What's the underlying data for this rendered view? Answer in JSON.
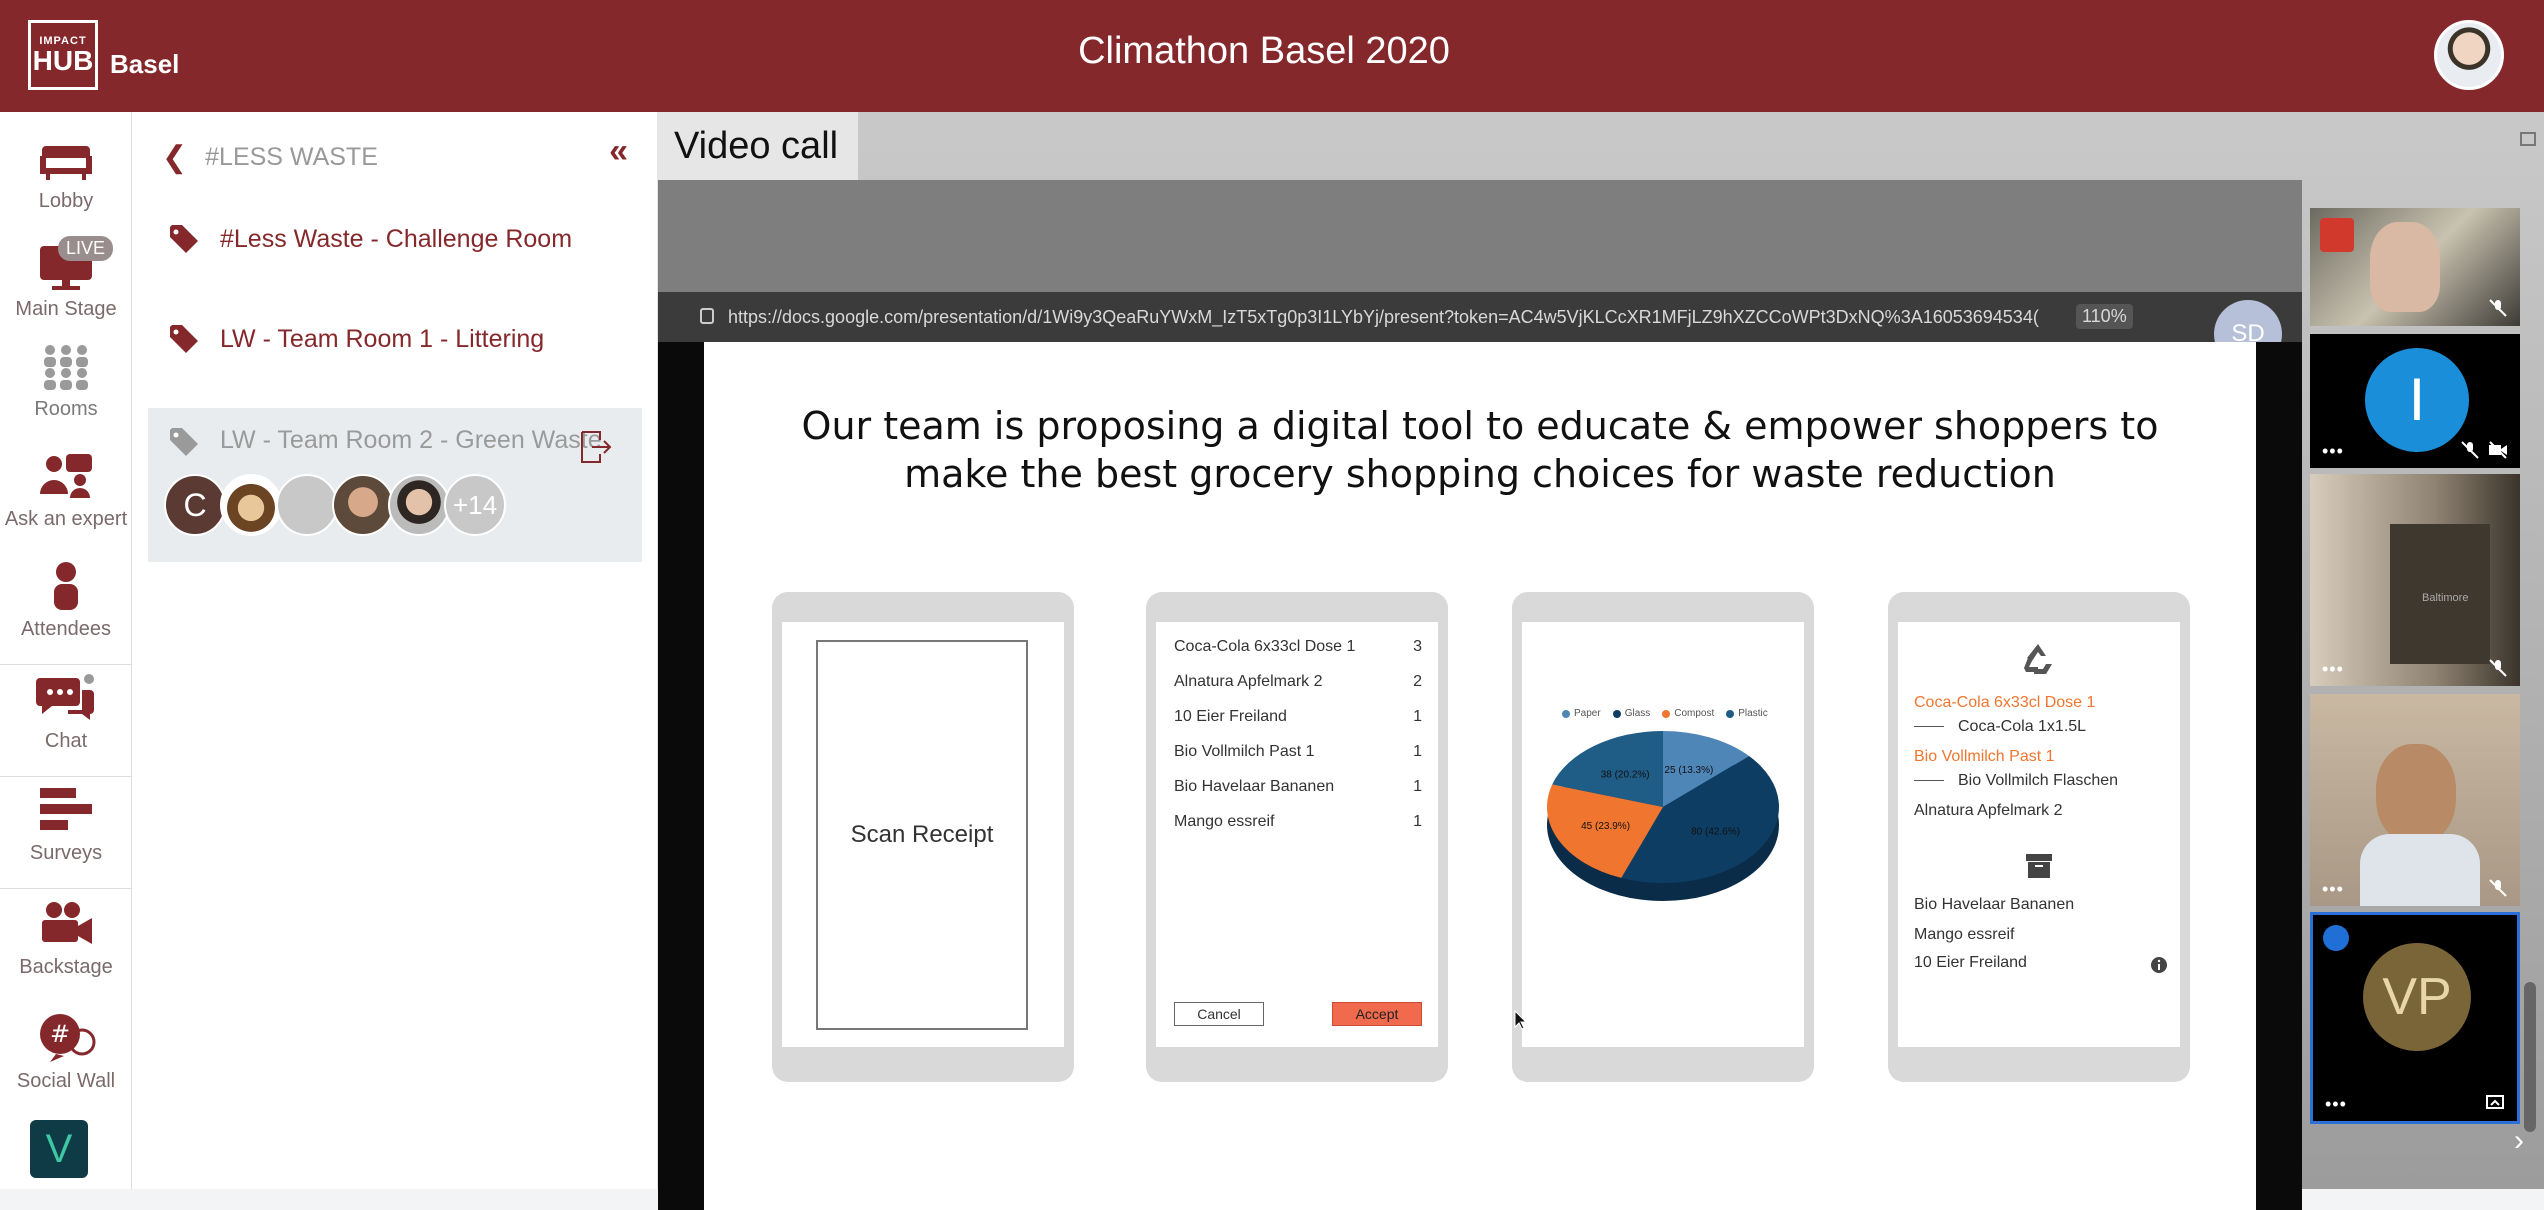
{
  "header": {
    "logo_small": "IMPACT",
    "logo_big": "HUB",
    "logo_city": "Basel",
    "title": "Climathon Basel 2020"
  },
  "nav": {
    "items": [
      {
        "label": "Lobby",
        "icon": "sofa-icon"
      },
      {
        "label": "Main Stage",
        "icon": "monitor-icon",
        "badge": "LIVE"
      },
      {
        "label": "Rooms",
        "icon": "rooms-icon"
      },
      {
        "label": "Ask an expert",
        "icon": "expert-icon"
      },
      {
        "label": "Attendees",
        "icon": "person-icon"
      },
      {
        "label": "Chat",
        "icon": "chat-icon"
      },
      {
        "label": "Surveys",
        "icon": "survey-icon"
      },
      {
        "label": "Backstage",
        "icon": "camera-icon"
      },
      {
        "label": "Social Wall",
        "icon": "hashtag-icon"
      }
    ],
    "brand_glyph": "V"
  },
  "rooms_panel": {
    "back_label": "#LESS WASTE",
    "rooms": [
      {
        "label": "#Less Waste - Challenge Room"
      },
      {
        "label": "LW - Team Room 1 - Littering"
      },
      {
        "label": "LW - Team Room 2 - Green Waste"
      }
    ],
    "avatar_initial": "C",
    "more_count": "+14"
  },
  "video": {
    "tab_label": "Video call",
    "url": "https://docs.google.com/presentation/d/1Wi9y3QeaRuYWxM_IzT5xTg0p3I1LYbYj/present?token=AC4w5VjKLCcXR1MFjLZ9hXZCCoWPt3DxNQ%3A16053694534(",
    "zoom": "110%",
    "presenter_initials": "SD"
  },
  "slide": {
    "title_line1": "Our team is proposing a digital tool to educate & empower shoppers to",
    "title_line2": "make the best grocery shopping choices for waste reduction",
    "scan_label": "Scan Receipt",
    "receipt_items": [
      {
        "name": "Coca-Cola 6x33cl Dose 1",
        "qty": "3"
      },
      {
        "name": "Alnatura Apfelmark 2",
        "qty": "2"
      },
      {
        "name": "10 Eier Freiland",
        "qty": "1"
      },
      {
        "name": "Bio Vollmilch Past 1",
        "qty": "1"
      },
      {
        "name": "Bio Havelaar Bananen",
        "qty": "1"
      },
      {
        "name": "Mango essreif",
        "qty": "1"
      }
    ],
    "cancel_label": "Cancel",
    "accept_label": "Accept",
    "pie_legend": [
      "Paper",
      "Glass",
      "Compost",
      "Plastic"
    ],
    "pie_slices": [
      {
        "label": "25 (13.3%)",
        "value": 25,
        "color": "#4f86b8"
      },
      {
        "label": "80 (42.6%)",
        "value": 80,
        "color": "#0d3d63"
      },
      {
        "label": "45 (23.9%)",
        "value": 45,
        "color": "#f0762f"
      },
      {
        "label": "38 (20.2%)",
        "value": 38,
        "color": "#1f5c86"
      }
    ],
    "alt_items": [
      {
        "text": "Coca-Cola 6x33cl Dose 1",
        "kind": "problem"
      },
      {
        "text": "Coca-Cola 1x1.5L",
        "kind": "alt"
      },
      {
        "text": "Bio Vollmilch Past 1",
        "kind": "problem"
      },
      {
        "text": "Bio Vollmilch Flaschen",
        "kind": "alt"
      },
      {
        "text": "Alnatura Apfelmark 2",
        "kind": "ok"
      },
      {
        "text": "Bio Havelaar Bananen",
        "kind": "ok"
      },
      {
        "text": "Mango essreif",
        "kind": "ok"
      },
      {
        "text": "10 Eier Freiland",
        "kind": "ok"
      }
    ]
  },
  "participants": {
    "letter_tile": "I",
    "vp_initials": "VP",
    "dots": "•••",
    "poster_text": "Baltimore"
  },
  "colors": {
    "brand": "#85282b",
    "accent_blue": "#1a8ed8",
    "accept": "#f26a4d"
  }
}
